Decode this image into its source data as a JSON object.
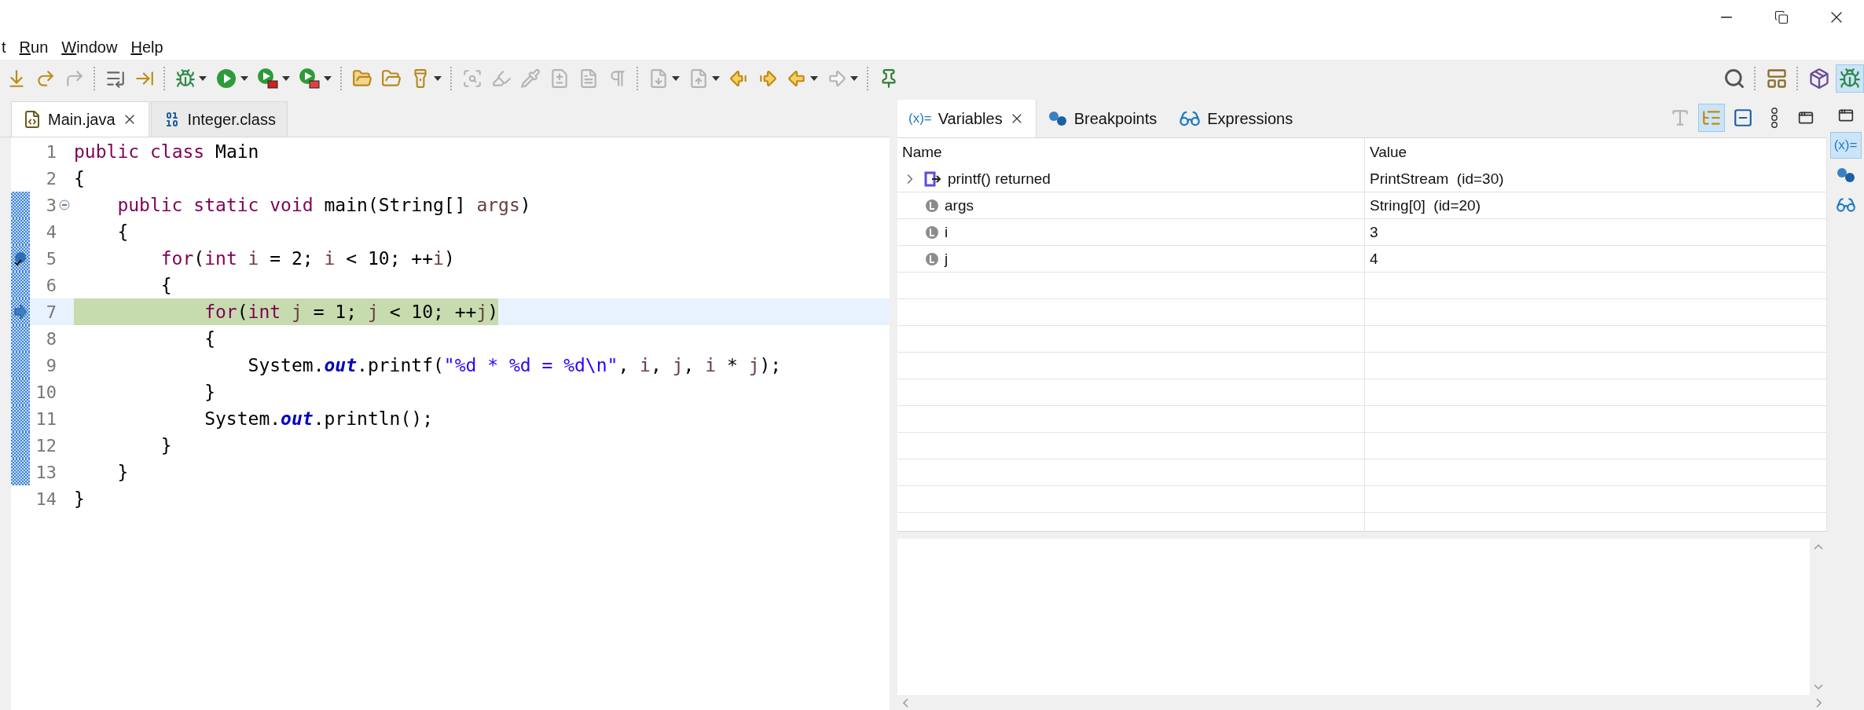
{
  "menu": [
    {
      "label": "t",
      "underline_first": false
    },
    {
      "label": "Run",
      "underline_first": true
    },
    {
      "label": "Window",
      "underline_first": true
    },
    {
      "label": "Help",
      "underline_first": true
    }
  ],
  "toolbar": [
    {
      "kind": "step-into",
      "disabled": false,
      "dropdown": false
    },
    {
      "kind": "step-over",
      "disabled": false,
      "dropdown": false
    },
    {
      "kind": "step-return",
      "disabled": true,
      "dropdown": false
    },
    {
      "kind": "separator"
    },
    {
      "kind": "step-filters",
      "disabled": false,
      "dropdown": false
    },
    {
      "kind": "step-selection",
      "disabled": false,
      "dropdown": false
    },
    {
      "kind": "separator"
    },
    {
      "kind": "debug",
      "disabled": false,
      "dropdown": true
    },
    {
      "kind": "run",
      "disabled": false,
      "dropdown": true
    },
    {
      "kind": "coverage",
      "disabled": false,
      "dropdown": true
    },
    {
      "kind": "external-tools",
      "disabled": false,
      "dropdown": true
    },
    {
      "kind": "separator"
    },
    {
      "kind": "open-type",
      "disabled": false,
      "dropdown": false
    },
    {
      "kind": "open-task",
      "disabled": false,
      "dropdown": false
    },
    {
      "kind": "search",
      "disabled": false,
      "dropdown": true
    },
    {
      "kind": "separator"
    },
    {
      "kind": "mark-occurrences",
      "disabled": true,
      "dropdown": false
    },
    {
      "kind": "highlight",
      "disabled": true,
      "dropdown": false
    },
    {
      "kind": "skip-breakpoints",
      "disabled": true,
      "dropdown": false
    },
    {
      "kind": "block-select",
      "disabled": true,
      "dropdown": false
    },
    {
      "kind": "word-wrap",
      "disabled": true,
      "dropdown": false
    },
    {
      "kind": "whitespace",
      "disabled": true,
      "dropdown": false
    },
    {
      "kind": "separator"
    },
    {
      "kind": "next-annotation",
      "disabled": true,
      "dropdown": true
    },
    {
      "kind": "prev-annotation",
      "disabled": true,
      "dropdown": true
    },
    {
      "kind": "last-edit-back",
      "disabled": false,
      "dropdown": false
    },
    {
      "kind": "last-edit-forward",
      "disabled": false,
      "dropdown": false
    },
    {
      "kind": "back",
      "disabled": false,
      "dropdown": true
    },
    {
      "kind": "forward",
      "disabled": true,
      "dropdown": true
    },
    {
      "kind": "separator"
    },
    {
      "kind": "pin",
      "disabled": false,
      "dropdown": false
    }
  ],
  "perspectives": [
    {
      "kind": "java",
      "selected": false
    },
    {
      "kind": "debug",
      "selected": true
    }
  ],
  "editor_tabs": [
    {
      "label": "Main.java",
      "kind": "java",
      "selected": true
    },
    {
      "label": "Integer.class",
      "kind": "class",
      "selected": false
    }
  ],
  "editor": {
    "lines": [
      {
        "number": "1",
        "current": false,
        "in_range": false,
        "breakpoint": false,
        "instruction_pointer": false,
        "foldable": false,
        "tokens": [
          {
            "kind": "keyword",
            "text": "public"
          },
          {
            "kind": "keyword",
            "text": " class"
          },
          {
            "kind": "plain",
            "text": " Main"
          }
        ]
      },
      {
        "number": "2",
        "current": false,
        "in_range": false,
        "breakpoint": false,
        "instruction_pointer": false,
        "foldable": false,
        "tokens": [
          {
            "kind": "plain",
            "text": "{"
          }
        ]
      },
      {
        "number": "3",
        "current": false,
        "in_range": true,
        "breakpoint": false,
        "instruction_pointer": false,
        "foldable": true,
        "tokens": [
          {
            "kind": "keyword",
            "text": "    public"
          },
          {
            "kind": "keyword",
            "text": " static"
          },
          {
            "kind": "keyword",
            "text": " void"
          },
          {
            "kind": "plain",
            "text": " main(String[] "
          },
          {
            "kind": "variable",
            "text": "args"
          },
          {
            "kind": "plain",
            "text": ")"
          }
        ]
      },
      {
        "number": "4",
        "current": false,
        "in_range": true,
        "breakpoint": false,
        "instruction_pointer": false,
        "foldable": false,
        "tokens": [
          {
            "kind": "plain",
            "text": "    {"
          }
        ]
      },
      {
        "number": "5",
        "current": false,
        "in_range": true,
        "breakpoint": true,
        "instruction_pointer": false,
        "foldable": false,
        "tokens": [
          {
            "kind": "keyword",
            "text": "        for"
          },
          {
            "kind": "plain",
            "text": "("
          },
          {
            "kind": "keyword",
            "text": "int"
          },
          {
            "kind": "variable",
            "text": " i"
          },
          {
            "kind": "plain",
            "text": " = 2; "
          },
          {
            "kind": "variable",
            "text": "i"
          },
          {
            "kind": "plain",
            "text": " < 10; ++"
          },
          {
            "kind": "variable",
            "text": "i"
          },
          {
            "kind": "plain",
            "text": ")"
          }
        ]
      },
      {
        "number": "6",
        "current": false,
        "in_range": true,
        "breakpoint": false,
        "instruction_pointer": false,
        "foldable": false,
        "tokens": [
          {
            "kind": "plain",
            "text": "        {"
          }
        ]
      },
      {
        "number": "7",
        "current": true,
        "in_range": true,
        "breakpoint": false,
        "instruction_pointer": true,
        "foldable": false,
        "tokens": [
          {
            "kind": "keyword",
            "text": "            for"
          },
          {
            "kind": "plain",
            "text": "("
          },
          {
            "kind": "keyword",
            "text": "int"
          },
          {
            "kind": "variable",
            "text": " j"
          },
          {
            "kind": "plain",
            "text": " = 1; "
          },
          {
            "kind": "variable",
            "text": "j"
          },
          {
            "kind": "plain",
            "text": " < 10; ++"
          },
          {
            "kind": "variable",
            "text": "j"
          },
          {
            "kind": "plain",
            "text": ")"
          }
        ]
      },
      {
        "number": "8",
        "current": false,
        "in_range": true,
        "breakpoint": false,
        "instruction_pointer": false,
        "foldable": false,
        "tokens": [
          {
            "kind": "plain",
            "text": "            {"
          }
        ]
      },
      {
        "number": "9",
        "current": false,
        "in_range": true,
        "breakpoint": false,
        "instruction_pointer": false,
        "foldable": false,
        "tokens": [
          {
            "kind": "plain",
            "text": "                System."
          },
          {
            "kind": "field",
            "text": "out"
          },
          {
            "kind": "plain",
            "text": ".printf("
          },
          {
            "kind": "string",
            "text": "\"%d * %d = %d\\n\""
          },
          {
            "kind": "plain",
            "text": ", "
          },
          {
            "kind": "variable",
            "text": "i"
          },
          {
            "kind": "plain",
            "text": ", "
          },
          {
            "kind": "variable",
            "text": "j"
          },
          {
            "kind": "plain",
            "text": ", "
          },
          {
            "kind": "variable",
            "text": "i"
          },
          {
            "kind": "plain",
            "text": " * "
          },
          {
            "kind": "variable",
            "text": "j"
          },
          {
            "kind": "plain",
            "text": ");"
          }
        ]
      },
      {
        "number": "10",
        "current": false,
        "in_range": true,
        "breakpoint": false,
        "instruction_pointer": false,
        "foldable": false,
        "tokens": [
          {
            "kind": "plain",
            "text": "            }"
          }
        ]
      },
      {
        "number": "11",
        "current": false,
        "in_range": true,
        "breakpoint": false,
        "instruction_pointer": false,
        "foldable": false,
        "tokens": [
          {
            "kind": "plain",
            "text": "            System."
          },
          {
            "kind": "field",
            "text": "out"
          },
          {
            "kind": "plain",
            "text": ".println();"
          }
        ]
      },
      {
        "number": "12",
        "current": false,
        "in_range": true,
        "breakpoint": false,
        "instruction_pointer": false,
        "foldable": false,
        "tokens": [
          {
            "kind": "plain",
            "text": "        }"
          }
        ]
      },
      {
        "number": "13",
        "current": false,
        "in_range": true,
        "breakpoint": false,
        "instruction_pointer": false,
        "foldable": false,
        "tokens": [
          {
            "kind": "plain",
            "text": "    }"
          }
        ]
      },
      {
        "number": "14",
        "current": false,
        "in_range": false,
        "breakpoint": false,
        "instruction_pointer": false,
        "foldable": false,
        "tokens": [
          {
            "kind": "plain",
            "text": "}"
          }
        ]
      }
    ]
  },
  "debug_views": {
    "tabs": [
      {
        "label": "Variables",
        "kind": "variables",
        "icon_text": "(x)=",
        "selected": true
      },
      {
        "label": "Breakpoints",
        "kind": "breakpoints",
        "selected": false
      },
      {
        "label": "Expressions",
        "kind": "expressions",
        "selected": false
      }
    ],
    "toolbar": [
      {
        "kind": "type-names",
        "selected": false,
        "disabled": true
      },
      {
        "kind": "logical-structure",
        "selected": true,
        "disabled": false
      },
      {
        "kind": "collapse-all",
        "selected": false,
        "disabled": false
      },
      {
        "kind": "menu",
        "selected": false,
        "disabled": false
      },
      {
        "kind": "minimize",
        "selected": false,
        "disabled": false
      }
    ],
    "table": {
      "columns": [
        "Name",
        "Value"
      ],
      "rows": [
        {
          "name": "printf() returned",
          "value": "PrintStream  (id=30)",
          "kind": "return",
          "expandable": true
        },
        {
          "name": "args",
          "value": "String[0]  (id=20)",
          "kind": "local",
          "expandable": false
        },
        {
          "name": "i",
          "value": "3",
          "kind": "local",
          "expandable": false
        },
        {
          "name": "j",
          "value": "4",
          "kind": "local",
          "expandable": false
        }
      ]
    }
  },
  "trim": [
    {
      "kind": "restore",
      "selected": false
    },
    {
      "kind": "variables",
      "icon_text": "(x)=",
      "selected": true
    },
    {
      "kind": "breakpoints",
      "selected": false
    },
    {
      "kind": "expressions",
      "selected": false
    }
  ]
}
